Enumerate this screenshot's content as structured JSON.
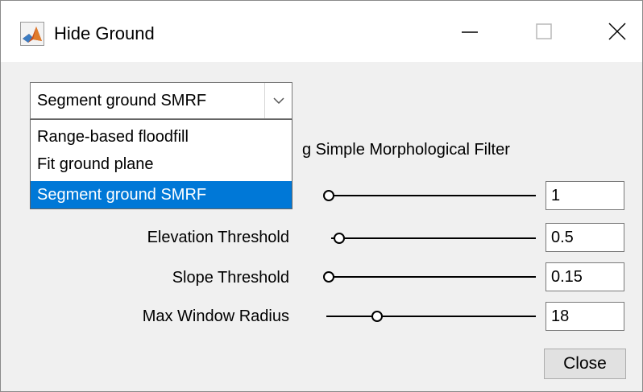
{
  "window": {
    "title": "Hide Ground",
    "icon": "matlab-logo-icon",
    "buttons": {
      "minimize": "minimize-icon",
      "maximize": "maximize-icon",
      "close": "close-icon"
    }
  },
  "method_dropdown": {
    "selected": "Segment ground SMRF",
    "options": [
      "Range-based floodfill",
      "Fit ground plane",
      "Segment ground SMRF"
    ],
    "highlight_color": "#0078d7"
  },
  "description_text": "g Simple Morphological Filter",
  "params": [
    {
      "label": "",
      "value": "1",
      "slider_fraction": 0.0
    },
    {
      "label": "Elevation Threshold",
      "value": "0.5",
      "slider_fraction": 0.03
    },
    {
      "label": "Slope Threshold",
      "value": "0.15",
      "slider_fraction": 0.0
    },
    {
      "label": "Max Window Radius",
      "value": "18",
      "slider_fraction": 0.24
    }
  ],
  "close_button": {
    "label": "Close"
  }
}
